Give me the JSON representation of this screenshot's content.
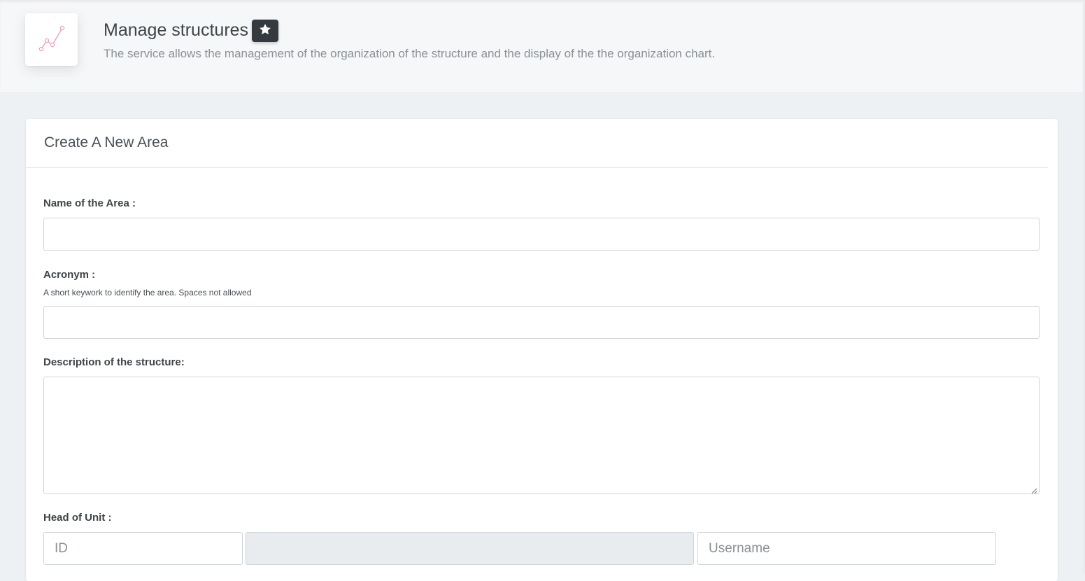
{
  "header": {
    "icon": "line-chart-icon",
    "title": "Manage structures",
    "favorite_icon": "star-icon",
    "subtitle": "The service allows the management of the organization of the structure and the display of the the organization chart."
  },
  "form": {
    "card_title": "Create A New Area",
    "name_label": "Name of the Area :",
    "name_value": "",
    "acronym_label": "Acronym :",
    "acronym_help": "A short keywork to identify the area. Spaces not allowed",
    "acronym_value": "",
    "description_label": "Description of the structure:",
    "description_value": "",
    "head_label": "Head of Unit :",
    "head_id_placeholder": "ID",
    "head_name_value": "",
    "head_username_placeholder": "Username"
  },
  "colors": {
    "icon_accent": "#e8a0b4",
    "favorite_bg": "#343a40"
  }
}
